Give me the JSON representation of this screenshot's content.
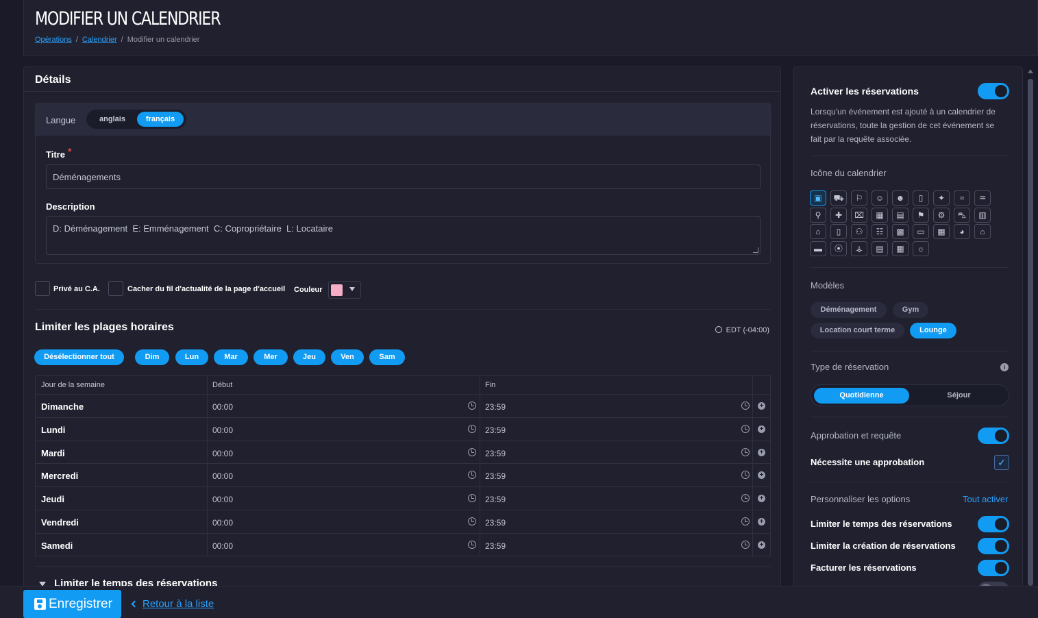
{
  "page": {
    "title": "MODIFIER UN CALENDRIER",
    "breadcrumb": [
      "Opérations",
      "Calendrier",
      "Modifier un calendrier"
    ]
  },
  "details": {
    "title": "Détails",
    "language_label": "Langue",
    "languages": [
      "anglais",
      "français"
    ],
    "active_language": "français",
    "title_label": "Titre",
    "required_mark": "*",
    "title_value": "Déménagements",
    "description_label": "Description",
    "description_value": "D: Déménagement  E: Emménagement  C: Copropriétaire  L: Locataire",
    "private_label": "Privé au C.A.",
    "hide_feed_label": "Cacher du fil d'actualité de la page d'accueil",
    "color_label": "Couleur",
    "color_value": "#f6aec8"
  },
  "schedule": {
    "title": "Limiter les plages horaires",
    "timezone": "EDT (-04:00)",
    "deselect_all": "Désélectionner tout",
    "days": [
      "Dim",
      "Lun",
      "Mar",
      "Mer",
      "Jeu",
      "Ven",
      "Sam"
    ],
    "headers": [
      "Jour de la semaine",
      "Début",
      "Fin"
    ],
    "rows": [
      {
        "day": "Dimanche",
        "start": "00:00",
        "end": "23:59"
      },
      {
        "day": "Lundi",
        "start": "00:00",
        "end": "23:59"
      },
      {
        "day": "Mardi",
        "start": "00:00",
        "end": "23:59"
      },
      {
        "day": "Mercredi",
        "start": "00:00",
        "end": "23:59"
      },
      {
        "day": "Jeudi",
        "start": "00:00",
        "end": "23:59"
      },
      {
        "day": "Vendredi",
        "start": "00:00",
        "end": "23:59"
      },
      {
        "day": "Samedi",
        "start": "00:00",
        "end": "23:59"
      }
    ],
    "collapsed_section": "Limiter le temps des réservations"
  },
  "sidebar": {
    "enable_title": "Activer les réservations",
    "enable_on": true,
    "enable_desc": "Lorsqu'un événement est ajouté à un calendrier de réservations, toute la gestion de cet événement se fait par la requête associée.",
    "icon_label": "Icône du calendrier",
    "icons": [
      "calendar-check-icon",
      "truck-icon",
      "mover-icon",
      "people-icon",
      "person-icon",
      "door-icon",
      "runner-icon",
      "swimmer-icon",
      "dumbbell-icon",
      "bicycle-icon",
      "cart-icon",
      "gift-box-icon",
      "calendar-icon",
      "clipboard-icon",
      "flag-icon",
      "bike-icon",
      "car-icon",
      "building-icon",
      "garage-icon",
      "elevator-icon",
      "group-icon",
      "team-icon",
      "storage-icon",
      "ticket-icon",
      "cake-icon",
      "pets-icon",
      "house-icon",
      "bed-icon",
      "map-pin-icon",
      "broom-icon",
      "parking-icon",
      "seating-icon",
      "bbq-icon"
    ],
    "icon_glyphs": [
      "▣",
      "⛟",
      "⚐",
      "☺",
      "☻",
      "▯",
      "✦",
      "≈",
      "♒",
      "⚲",
      "✚",
      "⌧",
      "▦",
      "▤",
      "⚑",
      "⚙",
      "⛍",
      "▥",
      "⌂",
      "▯",
      "⚇",
      "☷",
      "▩",
      "▭",
      "▦",
      "◕",
      "⌂",
      "▬",
      "⦿",
      "⚶",
      "▤",
      "▦",
      "☼"
    ],
    "selected_icon": 0,
    "models_label": "Modèles",
    "models": [
      "Déménagement",
      "Gym",
      "Location court terme",
      "Lounge"
    ],
    "active_model": "Lounge",
    "type_label": "Type de réservation",
    "info_glyph": "i",
    "types": [
      "Quotidienne",
      "Séjour"
    ],
    "active_type": "Quotidienne",
    "approval_label": "Approbation et requête",
    "approval_on": true,
    "needs_approval_label": "Nécessite une approbation",
    "needs_approval_checked": true,
    "check_glyph": "✓",
    "customize_label": "Personnaliser les options",
    "activate_all": "Tout activer",
    "options": [
      {
        "label": "Limiter le temps des réservations",
        "on": true
      },
      {
        "label": "Limiter la création de réservations",
        "on": true
      },
      {
        "label": "Facturer les réservations",
        "on": true
      }
    ]
  },
  "footer": {
    "save_label": "Enregistrer",
    "back_label": "Retour à la liste"
  },
  "colors": {
    "accent": "#129bf2",
    "background": "#1a1a28",
    "card": "#20202f"
  }
}
